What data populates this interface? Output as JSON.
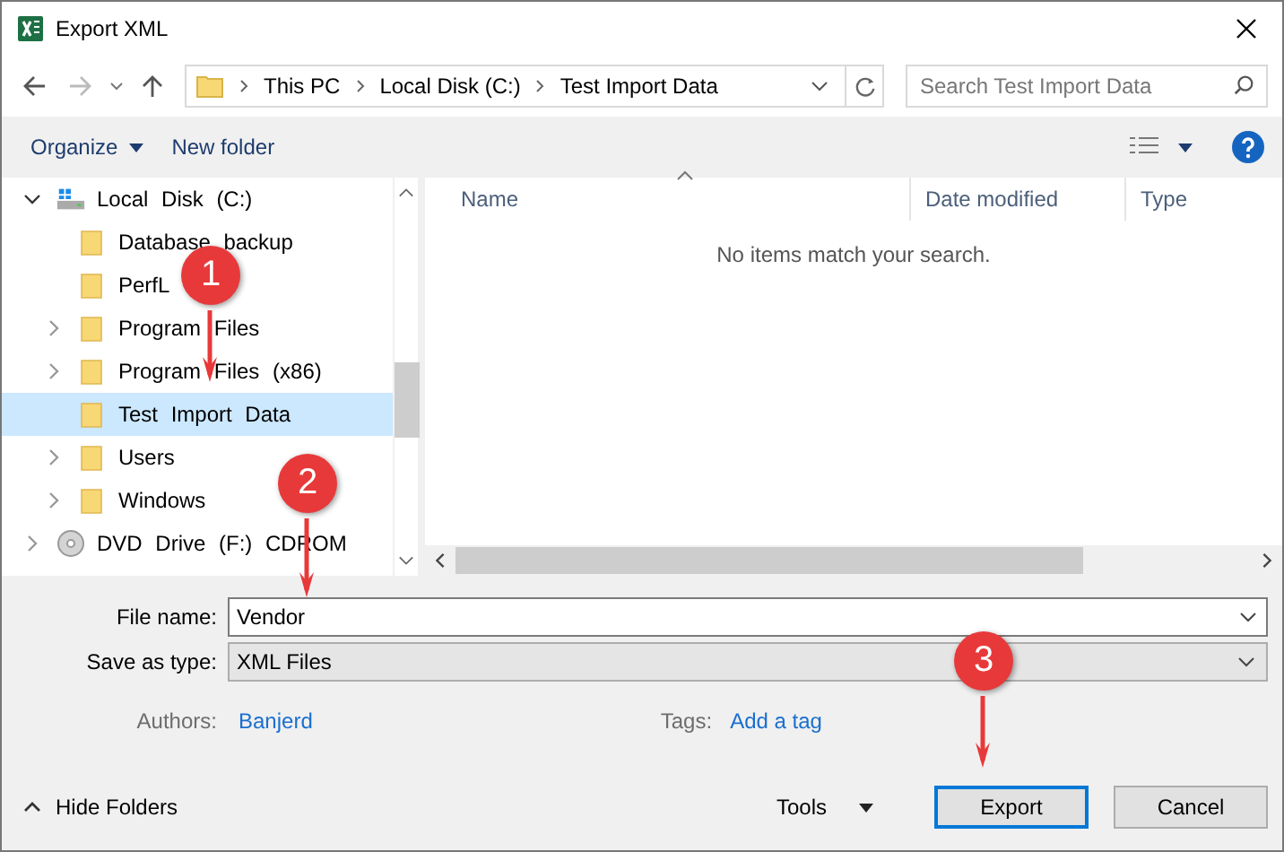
{
  "window": {
    "title": "Export XML"
  },
  "address": {
    "crumbs": [
      "This PC",
      "Local Disk (C:)",
      "Test Import Data"
    ],
    "search_placeholder": "Search Test Import Data"
  },
  "toolbar": {
    "organize": "Organize",
    "new_folder": "New folder"
  },
  "tree": [
    {
      "label": "Local Disk (C:)",
      "kind": "drive",
      "expanded": true,
      "selected": false,
      "children": [
        {
          "label": "Database backup",
          "kind": "folder",
          "selected": false
        },
        {
          "label": "PerfL",
          "kind": "folder",
          "selected": false
        },
        {
          "label": "Program Files",
          "kind": "folder",
          "expanded": false,
          "selected": false
        },
        {
          "label": "Program Files (x86)",
          "kind": "folder",
          "expanded": false,
          "selected": false
        },
        {
          "label": "Test Import Data",
          "kind": "folder",
          "selected": true
        },
        {
          "label": "Users",
          "kind": "folder",
          "expanded": false,
          "selected": false
        },
        {
          "label": "Windows",
          "kind": "folder",
          "expanded": false,
          "selected": false
        }
      ]
    },
    {
      "label": "DVD Drive (F:) CDROM",
      "kind": "dvd",
      "expanded": false,
      "selected": false
    }
  ],
  "list": {
    "columns": [
      "Name",
      "Date modified",
      "Type"
    ],
    "empty_message": "No items match your search."
  },
  "form": {
    "file_name_label": "File name:",
    "file_name": "Vendor",
    "type_label": "Save as type:",
    "type": "XML Files",
    "authors_label": "Authors:",
    "authors": "Banjerd",
    "tags_label": "Tags:",
    "tags": "Add a tag"
  },
  "footer": {
    "hide_folders": "Hide Folders",
    "tools": "Tools",
    "export": "Export",
    "cancel": "Cancel"
  },
  "callouts": [
    {
      "label": "1"
    },
    {
      "label": "2"
    },
    {
      "label": "3"
    }
  ]
}
